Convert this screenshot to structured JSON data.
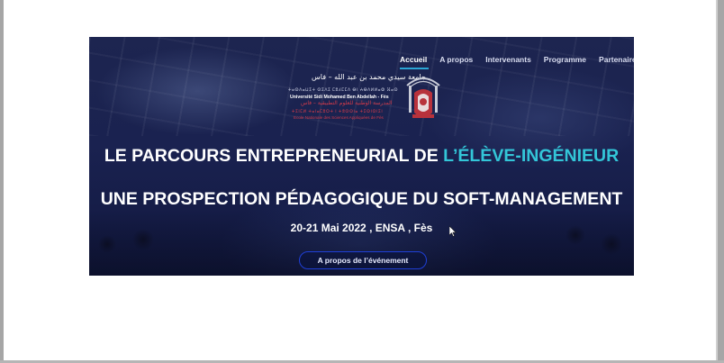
{
  "nav": {
    "items": [
      {
        "label": "Accueil",
        "active": true
      },
      {
        "label": "A propos",
        "active": false
      },
      {
        "label": "Intervenants",
        "active": false
      },
      {
        "label": "Programme",
        "active": false
      },
      {
        "label": "Partenaires",
        "active": false
      }
    ]
  },
  "logo": {
    "arabic_name": "جامعة سيدي محمد بن عبد الله – فاس",
    "amazigh_name": "ⵜⴰⵙⴷⴰⵡⵉⵜ ⵙⵉⴷⵉ ⵎⵓⵃⵎⵎⴷ ⴱⵏ ⵄⴱⴷⵍⵍⴰⵀ ⴼⴰⵙ",
    "french_name": "Université Sidi Mohamed Ben Abdellah - Fès",
    "school_arabic": "المدرسة الوطنية للعلوم التطبيقية – فاس",
    "school_amazigh": "ⵜⵉⵏⵎⵍ ⵜⴰⵏⴰⵎⵓⵔⵜ ⵏ ⵜⵓⵙⵙⵏⴰ ⵜⵉⵙⵏⵙⵏⵉⵏ",
    "school_french": "Ecole Nationale des Sciences Appliquées de Fès"
  },
  "hero": {
    "title_line1_prefix": "LE PARCOURS ENTREPRENEURIAL DE ",
    "title_line1_accent": "L’ÉLÈVE-INGÉNIEUR",
    "title_line2": "UNE PROSPECTION PÉDAGOGIQUE DU SOFT-MANAGEMENT",
    "date_location": "20-21 Mai 2022 , ENSA , Fès",
    "cta_label": "A propos de l’événement"
  },
  "colors": {
    "accent": "#33c6d8",
    "nav_underline": "#2ba6d6",
    "cta_border": "#1f3fd6",
    "hero_bg": "#1a2250"
  }
}
